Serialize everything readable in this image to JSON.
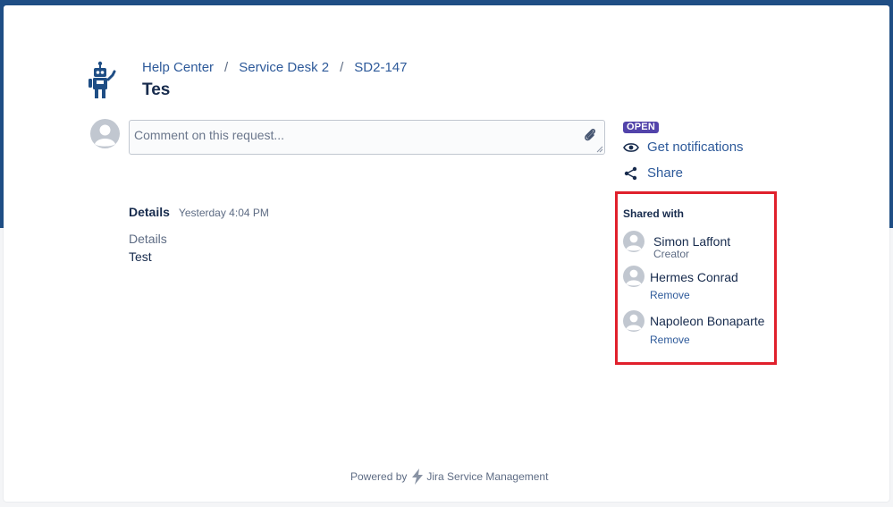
{
  "colors": {
    "header_band": "#1f4e85",
    "accent_link": "#2e5a9a",
    "status_badge": "#5243aa",
    "highlight_box": "#e0202c",
    "text_primary": "#172b4d",
    "text_secondary": "#5e6c84"
  },
  "breadcrumb": {
    "items": [
      "Help Center",
      "Service Desk 2",
      "SD2-147"
    ],
    "separator": "/"
  },
  "request": {
    "title": "Tes"
  },
  "comment": {
    "placeholder": "Comment on this request...",
    "icons": [
      "user-avatar-icon",
      "paperclip-icon"
    ]
  },
  "details": {
    "heading": "Details",
    "timestamp": "Yesterday 4:04 PM",
    "field_label": "Details",
    "field_value": "Test"
  },
  "sidebar": {
    "status": "OPEN",
    "actions": [
      {
        "label": "Get notifications",
        "icon": "eye-icon"
      },
      {
        "label": "Share",
        "icon": "share-icon"
      }
    ]
  },
  "shared_with": {
    "title": "Shared with",
    "people": [
      {
        "name": "Simon Laffont",
        "role": "Creator"
      },
      {
        "name": "Hermes Conrad",
        "action": "Remove"
      },
      {
        "name": "Napoleon Bonaparte",
        "action": "Remove"
      }
    ]
  },
  "footer": {
    "powered_by": "Powered by",
    "product": "Jira Service Management"
  }
}
